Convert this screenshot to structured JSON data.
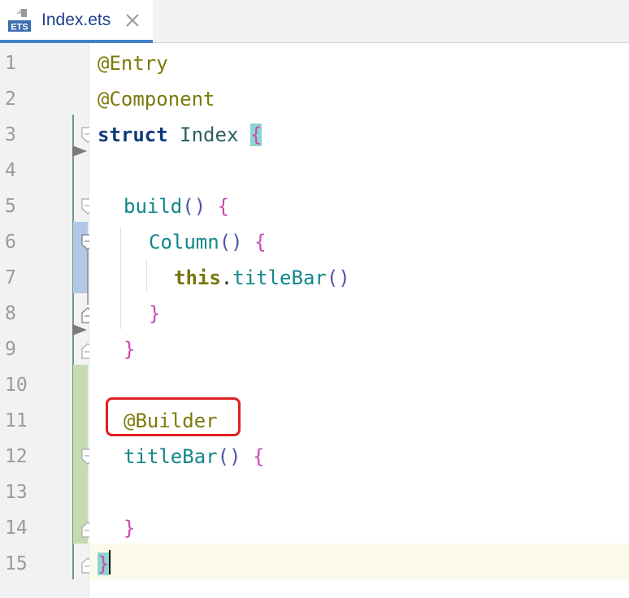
{
  "tab": {
    "filename": "Index.ets",
    "icon": "ets-file-icon",
    "icon_text": "ETS",
    "close_icon": "close-icon"
  },
  "editor": {
    "line_numbers": [
      "1",
      "2",
      "3",
      "4",
      "5",
      "6",
      "7",
      "8",
      "9",
      "10",
      "11",
      "12",
      "13",
      "14",
      "15"
    ],
    "current_line": "15",
    "code": {
      "l1_annotation": "@Entry",
      "l2_annotation": "@Component",
      "l3_keyword": "struct",
      "l3_name": "Index",
      "l3_brace": "{",
      "l5_fn": "build",
      "l5_parens": "()",
      "l5_brace": "{",
      "l6_fn": "Column",
      "l6_parens": "()",
      "l6_brace": "{",
      "l7_this": "this",
      "l7_dot": ".",
      "l7_fn": "titleBar",
      "l7_parens": "()",
      "l8_brace": "}",
      "l9_brace": "}",
      "l11_annotation": "@Builder",
      "l12_fn": "titleBar",
      "l12_parens": "()",
      "l12_brace": "{",
      "l14_brace": "}",
      "l15_brace": "}"
    }
  },
  "colors": {
    "highlight_box": "#e02020",
    "annotation": "#7c7a0a",
    "function": "#11868b",
    "brace": "#c94ab3",
    "tab_underline": "#4083c9"
  }
}
